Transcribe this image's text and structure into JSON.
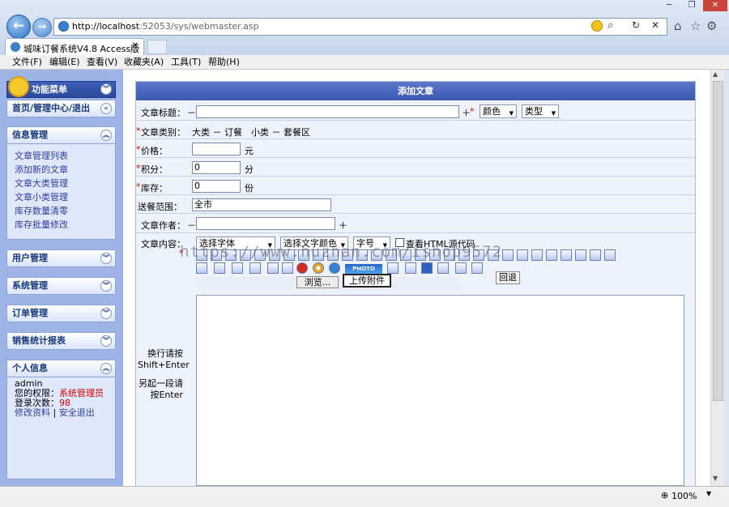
{
  "browser": {
    "url_host": "http://localhost",
    "url_path": ":52053/sys/webmaster.asp",
    "tab_title": "城味订餐系统V4.8 Access版",
    "zoom": "100%",
    "menu": [
      "文件(F)",
      "编辑(E)",
      "查看(V)",
      "收藏夹(A)",
      "工具(T)",
      "帮助(H)"
    ]
  },
  "sidebar": {
    "title": "功能菜单",
    "home": "首页/管理中心/退出",
    "info_mgmt": {
      "title": "信息管理",
      "items": [
        "文章管理列表",
        "添加新的文章",
        "文章大类管理",
        "文章小类管理",
        "库存数量清零",
        "库存批量修改"
      ]
    },
    "user_mgmt": "用户管理",
    "system_mgmt": "系统管理",
    "order_mgmt": "订单管理",
    "sales_report": "销售统计报表",
    "personal": {
      "title": "个人信息",
      "username": "admin",
      "role_label": "您的权限：",
      "role_value": "系统管理员",
      "login_label": "登录次数：",
      "login_value": "98",
      "edit_profile": "修改资料",
      "separator": "|",
      "logout": "安全退出"
    }
  },
  "form": {
    "header": "添加文章",
    "title_label": "文章标题：",
    "dash": "－",
    "plus": "＋",
    "star": "*",
    "color_select": "颜色",
    "type_select": "类型",
    "category_label": "文章类别：",
    "category_value": "大类 － 订餐　小类 － 套餐区",
    "price_label": "价格：",
    "price_unit": "元",
    "points_label": "积分：",
    "points_value": "0",
    "points_unit": "分",
    "stock_label": "库存：",
    "stock_value": "0",
    "stock_unit": "份",
    "delivery_label": "送餐范围：",
    "delivery_value": "全市",
    "author_label": "文章作者：",
    "content_label": "文章内容：",
    "font_select": "选择字体",
    "color_text_select": "选择文字颜色",
    "size_select": "字号",
    "html_source_label": "查看HTML源代码",
    "browse_button": "浏览...",
    "upload_button": "上传附件",
    "return_button": "回退",
    "enter_hint1": "换行请按Shift+Enter",
    "enter_hint2": "另起一段请按Enter",
    "photo_label": "PHOTO"
  },
  "watermark": "https://www.huzhan.com/ishop9572",
  "colors": {
    "form_header": "#3a58b0",
    "sidebar_bg": "#9eb3e6",
    "link": "#2d3ea0",
    "required_star": "#dd0000"
  }
}
